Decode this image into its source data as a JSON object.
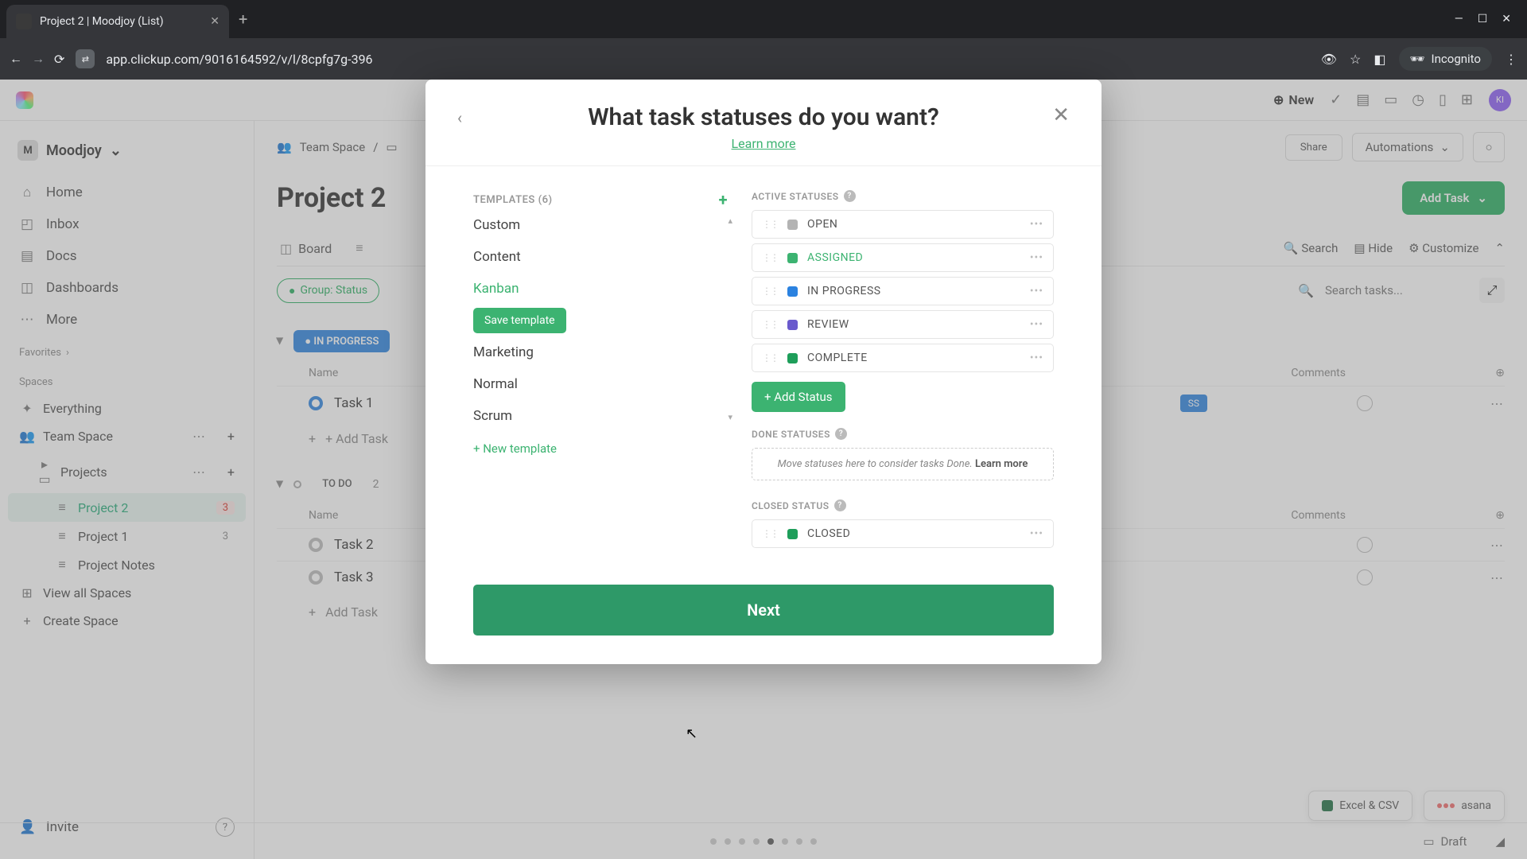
{
  "browser": {
    "tab_title": "Project 2 | Moodjoy (List)",
    "url": "app.clickup.com/9016164592/v/l/8cpfg7g-396",
    "incognito_label": "Incognito"
  },
  "topbar": {
    "new_label": "New"
  },
  "sidebar": {
    "workspace": "Moodjoy",
    "workspace_initial": "M",
    "nav": {
      "home": "Home",
      "inbox": "Inbox",
      "docs": "Docs",
      "dashboards": "Dashboards",
      "more": "More"
    },
    "favorites_label": "Favorites",
    "spaces_label": "Spaces",
    "everything": "Everything",
    "team_space": "Team Space",
    "projects": "Projects",
    "project2": "Project 2",
    "project2_count": "3",
    "project1": "Project 1",
    "project1_count": "3",
    "project_notes": "Project Notes",
    "view_all": "View all Spaces",
    "create_space": "Create Space",
    "invite": "Invite"
  },
  "main": {
    "breadcrumb_space": "Team Space",
    "title": "Project 2",
    "share": "Share",
    "automations": "Automations",
    "add_task": "Add Task",
    "tabs": {
      "board": "Board"
    },
    "tools": {
      "search": "Search",
      "hide": "Hide",
      "customize": "Customize"
    },
    "group_pill": "Group: Status",
    "search_placeholder": "Search tasks...",
    "groups": {
      "in_progress": {
        "label": "IN PROGRESS"
      },
      "todo": {
        "label": "TO DO",
        "count": "2"
      }
    },
    "columns": {
      "name": "Name",
      "comments": "Comments"
    },
    "tasks": {
      "t1": "Task 1",
      "t2": "Task 2",
      "t3": "Task 3"
    },
    "add_task_text": "+ Add Task",
    "excel_label": "Excel & CSV",
    "asana_label": "asana",
    "draft_label": "Draft"
  },
  "modal": {
    "title": "What task statuses do you want?",
    "learn_more": "Learn more",
    "templates_header": "TEMPLATES (6)",
    "templates": {
      "custom": "Custom",
      "content": "Content",
      "kanban": "Kanban",
      "save_template": "Save template",
      "marketing": "Marketing",
      "normal": "Normal",
      "scrum": "Scrum",
      "new_template": "+ New template"
    },
    "active_header": "ACTIVE STATUSES",
    "statuses": {
      "open": {
        "label": "OPEN",
        "color": "#b3b3b3"
      },
      "assigned": {
        "label": "ASSIGNED",
        "color": "#3cb371"
      },
      "in_progress": {
        "label": "IN PROGRESS",
        "color": "#2b82e0"
      },
      "review": {
        "label": "REVIEW",
        "color": "#6a5acd"
      },
      "complete": {
        "label": "COMPLETE",
        "color": "#1e9e5a"
      }
    },
    "add_status": "+ Add Status",
    "done_header": "DONE STATUSES",
    "done_hint": "Move statuses here to consider tasks Done.",
    "done_learn": "Learn more",
    "closed_header": "CLOSED STATUS",
    "closed": {
      "label": "CLOSED",
      "color": "#1e9e5a"
    },
    "next": "Next"
  }
}
